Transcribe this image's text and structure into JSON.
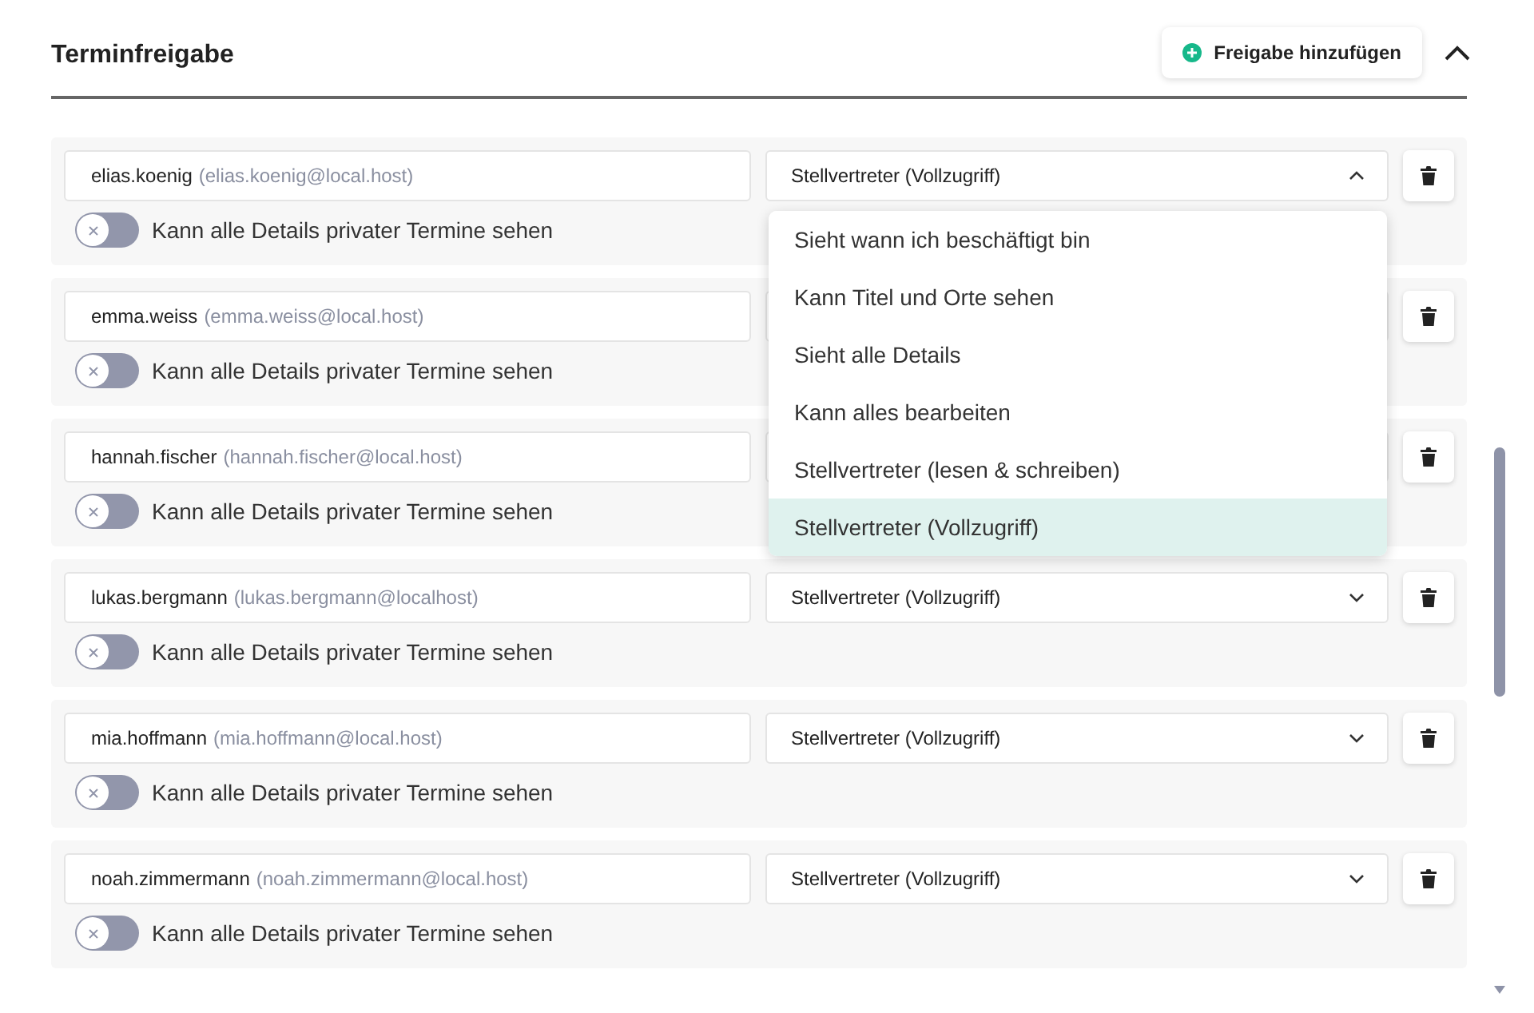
{
  "section": {
    "title": "Terminfreigabe",
    "add_button": "Freigabe hinzufügen",
    "expanded": true
  },
  "shares": [
    {
      "user": "elias.koenig",
      "email": "(elias.koenig@local.host)",
      "permission": "Stellvertreter (Vollzugriff)",
      "dropdown_open": true,
      "private_toggle": {
        "label": "Kann alle Details privater Termine sehen",
        "on": false
      }
    },
    {
      "user": "emma.weiss",
      "email": "(emma.weiss@local.host)",
      "private_toggle": {
        "label": "Kann alle Details privater Termine sehen",
        "on": false
      }
    },
    {
      "user": "hannah.fischer",
      "email": "(hannah.fischer@local.host)",
      "private_toggle": {
        "label": "Kann alle Details privater Termine sehen",
        "on": false
      }
    },
    {
      "user": "lukas.bergmann",
      "email": "(lukas.bergmann@localhost)",
      "permission": "Stellvertreter (Vollzugriff)",
      "dropdown_open": false,
      "private_toggle": {
        "label": "Kann alle Details privater Termine sehen",
        "on": false
      }
    },
    {
      "user": "mia.hoffmann",
      "email": "(mia.hoffmann@local.host)",
      "permission": "Stellvertreter (Vollzugriff)",
      "dropdown_open": false,
      "private_toggle": {
        "label": "Kann alle Details privater Termine sehen",
        "on": false
      }
    },
    {
      "user": "noah.zimmermann",
      "email": "(noah.zimmermann@local.host)",
      "permission": "Stellvertreter (Vollzugriff)",
      "dropdown_open": false,
      "private_toggle": {
        "label": "Kann alle Details privater Termine sehen",
        "on": false
      }
    }
  ],
  "permission_menu": [
    {
      "label": "Sieht wann ich beschäftigt bin",
      "selected": false
    },
    {
      "label": "Kann Titel und Orte sehen",
      "selected": false
    },
    {
      "label": "Sieht alle Details",
      "selected": false
    },
    {
      "label": "Kann alles bearbeiten",
      "selected": false
    },
    {
      "label": "Stellvertreter (lesen & schreiben)",
      "selected": false
    },
    {
      "label": "Stellvertreter (Vollzugriff)",
      "selected": true
    }
  ]
}
